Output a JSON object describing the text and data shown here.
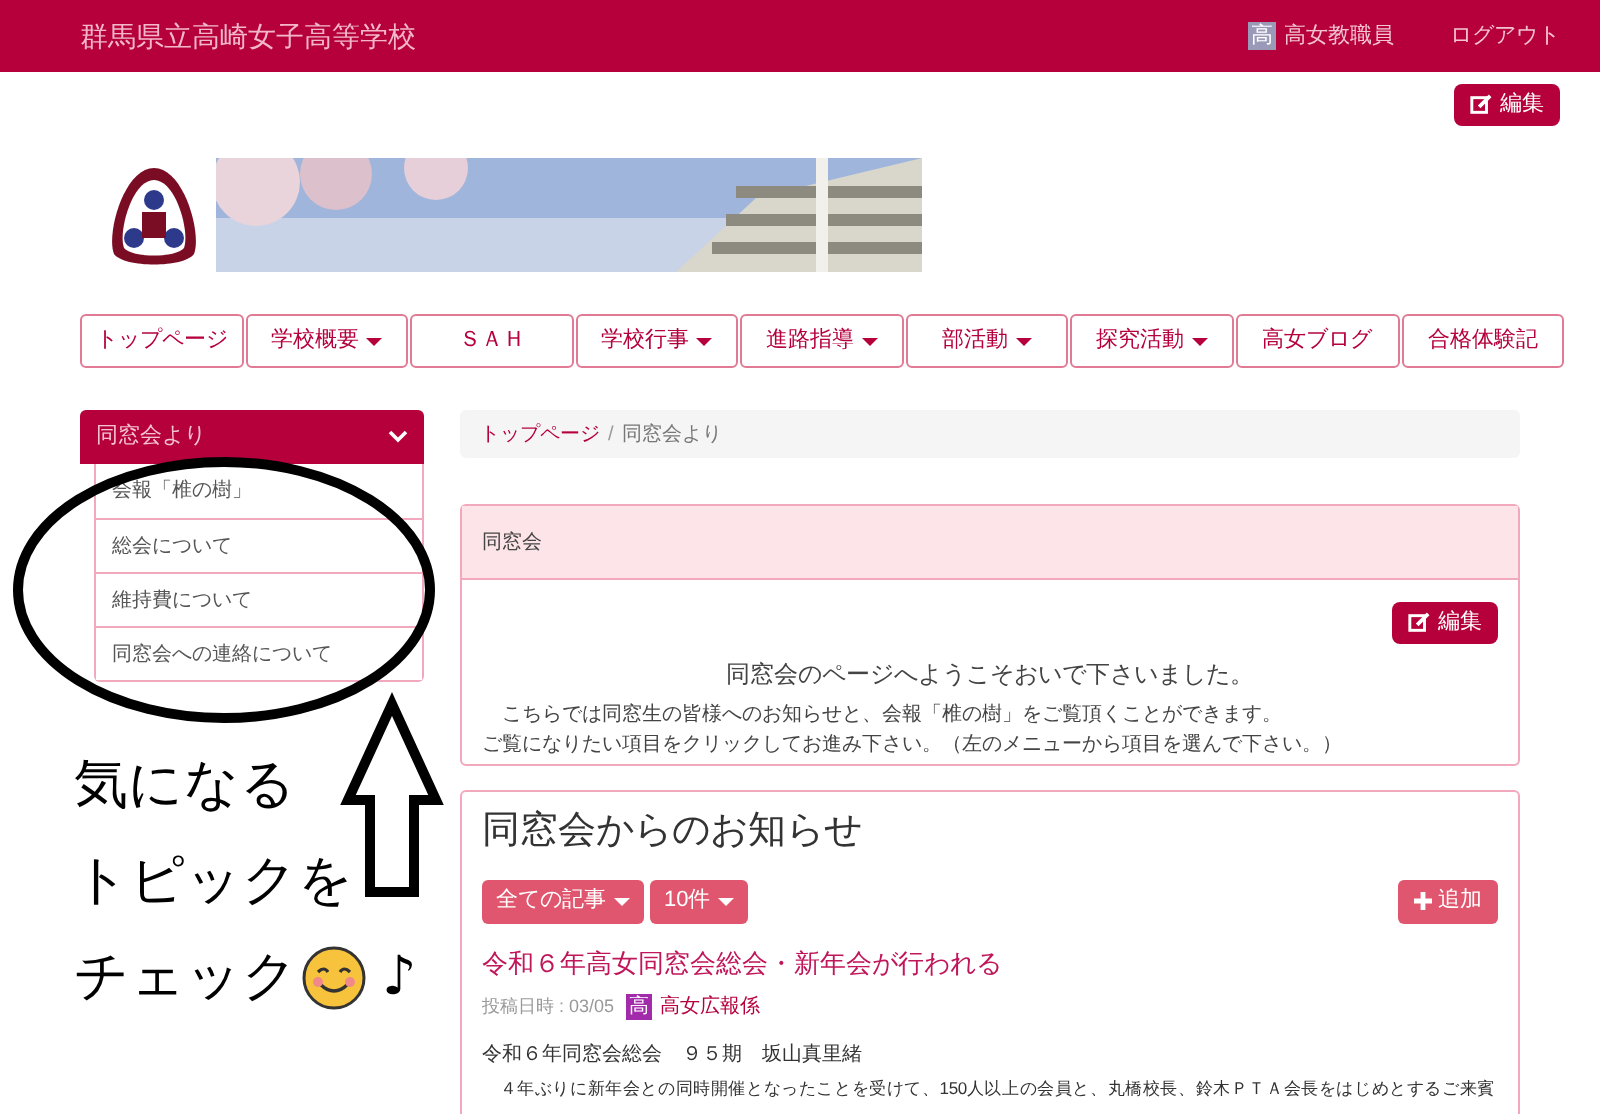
{
  "top_bar": {
    "site_title": "群馬県立高崎女子高等学校",
    "user_badge": "高",
    "user_name": "高女教職員",
    "logout": "ログアウト"
  },
  "page_edit_button": "編集",
  "nav": [
    {
      "label": "トップページ",
      "dropdown": false
    },
    {
      "label": "学校概要",
      "dropdown": true
    },
    {
      "label": "ＳＡＨ",
      "dropdown": false
    },
    {
      "label": "学校行事",
      "dropdown": true
    },
    {
      "label": "進路指導",
      "dropdown": true
    },
    {
      "label": "部活動",
      "dropdown": true
    },
    {
      "label": "探究活動",
      "dropdown": true
    },
    {
      "label": "高女ブログ",
      "dropdown": false
    },
    {
      "label": "合格体験記",
      "dropdown": false
    }
  ],
  "sidebar": {
    "title": "同窓会より",
    "expanded": true,
    "items": [
      {
        "label": "会報「椎の樹」"
      },
      {
        "label": "総会について"
      },
      {
        "label": "維持費について"
      },
      {
        "label": "同窓会への連絡について"
      }
    ]
  },
  "breadcrumb_separator": "/",
  "breadcrumb": [
    {
      "label": "トップページ",
      "link": true
    },
    {
      "label": "同窓会より",
      "link": false
    }
  ],
  "intro_panel": {
    "heading": "同窓会",
    "edit_button": "編集",
    "title": "同窓会のページへようこそおいで下さいました。",
    "lines": [
      "　こちらでは同窓生の皆様へのお知らせと、会報「椎の樹」をご覧頂くことができます。",
      "ご覧になりたい項目をクリックしてお進み下さい。（左のメニューから項目を選んで下さい。）"
    ]
  },
  "news_panel": {
    "heading": "同窓会からのお知らせ",
    "filters": [
      "全ての記事",
      "10件"
    ],
    "add_button": "追加",
    "article": {
      "title": "令和６年高女同窓会総会・新年会が行われる",
      "date_label": "投稿日時 : 03/05",
      "author_badge": "高",
      "author": "高女広報係",
      "subtitle": "令和６年同窓会総会　９５期　坂山真里緒",
      "body": "　４年ぶりに新年会との同時開催となったことを受けて、150人以上の会員と、丸橋校長、鈴木ＰＴＡ会長をはじめとするご来賓"
    }
  },
  "annotation": {
    "lines": [
      "気になる",
      "トピックを",
      "チェック"
    ],
    "note": "♪"
  }
}
